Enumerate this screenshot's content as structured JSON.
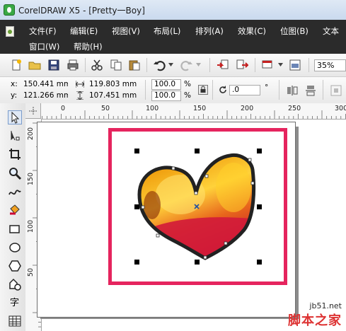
{
  "window": {
    "title": "CorelDRAW X5 - [Pretty一Boy]"
  },
  "menu": {
    "row1": [
      "文件(F)",
      "编辑(E)",
      "视图(V)",
      "布局(L)",
      "排列(A)",
      "效果(C)",
      "位图(B)",
      "文本"
    ],
    "row2": [
      "窗口(W)",
      "帮助(H)"
    ]
  },
  "toolbar": {
    "zoom": "35%"
  },
  "properties": {
    "x_label": "x:",
    "x_value": "150.441 mm",
    "y_label": "y:",
    "y_value": "121.266 mm",
    "width_value": "119.803 mm",
    "height_value": "107.451 mm",
    "scale_x": "100.0",
    "scale_y": "100.0",
    "percent_symbol": "%",
    "rotation": ".0",
    "degree_symbol": "°"
  },
  "ruler": {
    "top_labels": [
      "0",
      "50",
      "100",
      "150",
      "200",
      "250",
      "300"
    ],
    "left_labels": [
      "200",
      "150",
      "100",
      "50"
    ]
  },
  "tools": {
    "text_tool_glyph": "字"
  },
  "watermark": {
    "site": "jb51.net",
    "brand": "脚本之家"
  },
  "colors": {
    "frame": "#e5245e",
    "menubar": "#2b2b2b"
  }
}
